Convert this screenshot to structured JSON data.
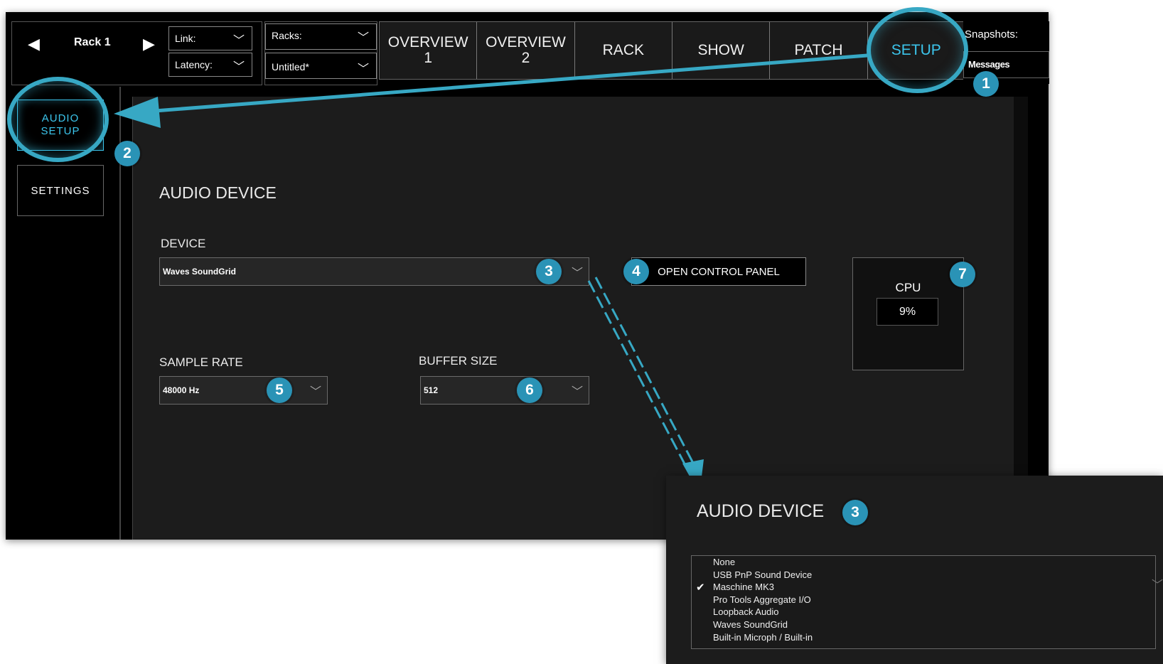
{
  "topbar": {
    "rack_prev_icon": "◀",
    "rack_name": "Rack 1",
    "rack_next_icon": "▶",
    "link_label": "Link:",
    "latency_label": "Latency:",
    "racks_label": "Racks:",
    "show_name": "Untitled*",
    "chevron": "﹀",
    "tabs": [
      {
        "line1": "OVERVIEW",
        "line2": "1"
      },
      {
        "line1": "OVERVIEW",
        "line2": "2"
      },
      {
        "line1": "RACK",
        "line2": ""
      },
      {
        "line1": "SHOW",
        "line2": ""
      },
      {
        "line1": "PATCH",
        "line2": ""
      },
      {
        "line1": "SETUP",
        "line2": ""
      }
    ],
    "active_tab": "SETUP",
    "snapshots_label": "Snapshots:",
    "messages_label": "Messages"
  },
  "sidebar": {
    "audio_setup_line1": "AUDIO",
    "audio_setup_line2": "SETUP",
    "settings": "SETTINGS"
  },
  "main": {
    "heading": "AUDIO DEVICE",
    "device_label": "DEVICE",
    "device_value": "Waves SoundGrid",
    "open_control_panel": "OPEN CONTROL PANEL",
    "cpu_label": "CPU",
    "cpu_value": "9%",
    "sample_rate_label": "SAMPLE RATE",
    "sample_rate_value": "48000 Hz",
    "buffer_size_label": "BUFFER SIZE",
    "buffer_size_value": "512"
  },
  "badges": [
    "1",
    "2",
    "3",
    "4",
    "5",
    "6",
    "7"
  ],
  "popup": {
    "heading": "AUDIO DEVICE",
    "badge": "3",
    "items": [
      "None",
      "USB PnP Sound Device",
      "Maschine MK3",
      "Pro Tools Aggregate I/O",
      "Loopback Audio",
      "Waves SoundGrid",
      "Built-in Microph / Built-in"
    ],
    "checked_item": "Maschine MK3",
    "check_icon": "✔"
  },
  "colors": {
    "accent": "#3cc5ec",
    "badge": "#2a93b6",
    "annotation": "#37a8c4",
    "panel": "#1c1c1c"
  }
}
